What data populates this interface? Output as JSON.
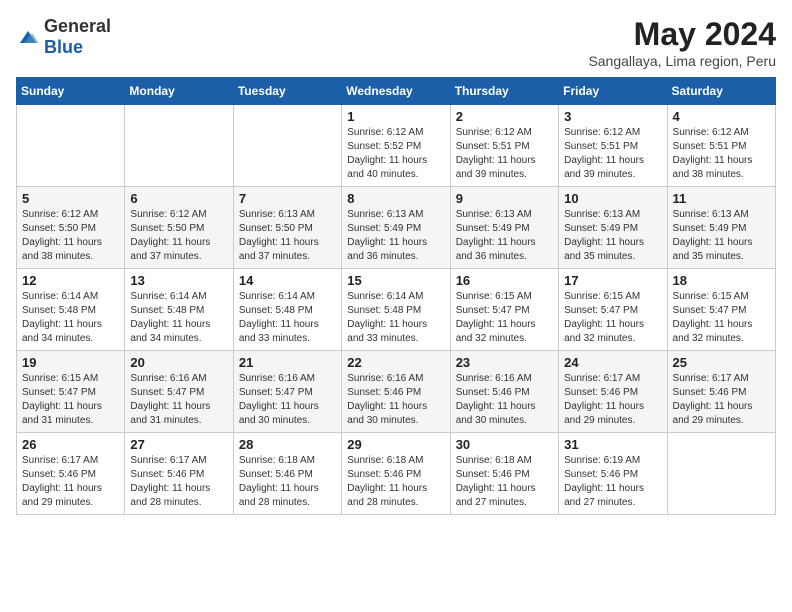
{
  "logo": {
    "text_general": "General",
    "text_blue": "Blue"
  },
  "header": {
    "month_title": "May 2024",
    "location": "Sangallaya, Lima region, Peru"
  },
  "weekdays": [
    "Sunday",
    "Monday",
    "Tuesday",
    "Wednesday",
    "Thursday",
    "Friday",
    "Saturday"
  ],
  "weeks": [
    [
      {
        "day": "",
        "info": ""
      },
      {
        "day": "",
        "info": ""
      },
      {
        "day": "",
        "info": ""
      },
      {
        "day": "1",
        "info": "Sunrise: 6:12 AM\nSunset: 5:52 PM\nDaylight: 11 hours\nand 40 minutes."
      },
      {
        "day": "2",
        "info": "Sunrise: 6:12 AM\nSunset: 5:51 PM\nDaylight: 11 hours\nand 39 minutes."
      },
      {
        "day": "3",
        "info": "Sunrise: 6:12 AM\nSunset: 5:51 PM\nDaylight: 11 hours\nand 39 minutes."
      },
      {
        "day": "4",
        "info": "Sunrise: 6:12 AM\nSunset: 5:51 PM\nDaylight: 11 hours\nand 38 minutes."
      }
    ],
    [
      {
        "day": "5",
        "info": "Sunrise: 6:12 AM\nSunset: 5:50 PM\nDaylight: 11 hours\nand 38 minutes."
      },
      {
        "day": "6",
        "info": "Sunrise: 6:12 AM\nSunset: 5:50 PM\nDaylight: 11 hours\nand 37 minutes."
      },
      {
        "day": "7",
        "info": "Sunrise: 6:13 AM\nSunset: 5:50 PM\nDaylight: 11 hours\nand 37 minutes."
      },
      {
        "day": "8",
        "info": "Sunrise: 6:13 AM\nSunset: 5:49 PM\nDaylight: 11 hours\nand 36 minutes."
      },
      {
        "day": "9",
        "info": "Sunrise: 6:13 AM\nSunset: 5:49 PM\nDaylight: 11 hours\nand 36 minutes."
      },
      {
        "day": "10",
        "info": "Sunrise: 6:13 AM\nSunset: 5:49 PM\nDaylight: 11 hours\nand 35 minutes."
      },
      {
        "day": "11",
        "info": "Sunrise: 6:13 AM\nSunset: 5:49 PM\nDaylight: 11 hours\nand 35 minutes."
      }
    ],
    [
      {
        "day": "12",
        "info": "Sunrise: 6:14 AM\nSunset: 5:48 PM\nDaylight: 11 hours\nand 34 minutes."
      },
      {
        "day": "13",
        "info": "Sunrise: 6:14 AM\nSunset: 5:48 PM\nDaylight: 11 hours\nand 34 minutes."
      },
      {
        "day": "14",
        "info": "Sunrise: 6:14 AM\nSunset: 5:48 PM\nDaylight: 11 hours\nand 33 minutes."
      },
      {
        "day": "15",
        "info": "Sunrise: 6:14 AM\nSunset: 5:48 PM\nDaylight: 11 hours\nand 33 minutes."
      },
      {
        "day": "16",
        "info": "Sunrise: 6:15 AM\nSunset: 5:47 PM\nDaylight: 11 hours\nand 32 minutes."
      },
      {
        "day": "17",
        "info": "Sunrise: 6:15 AM\nSunset: 5:47 PM\nDaylight: 11 hours\nand 32 minutes."
      },
      {
        "day": "18",
        "info": "Sunrise: 6:15 AM\nSunset: 5:47 PM\nDaylight: 11 hours\nand 32 minutes."
      }
    ],
    [
      {
        "day": "19",
        "info": "Sunrise: 6:15 AM\nSunset: 5:47 PM\nDaylight: 11 hours\nand 31 minutes."
      },
      {
        "day": "20",
        "info": "Sunrise: 6:16 AM\nSunset: 5:47 PM\nDaylight: 11 hours\nand 31 minutes."
      },
      {
        "day": "21",
        "info": "Sunrise: 6:16 AM\nSunset: 5:47 PM\nDaylight: 11 hours\nand 30 minutes."
      },
      {
        "day": "22",
        "info": "Sunrise: 6:16 AM\nSunset: 5:46 PM\nDaylight: 11 hours\nand 30 minutes."
      },
      {
        "day": "23",
        "info": "Sunrise: 6:16 AM\nSunset: 5:46 PM\nDaylight: 11 hours\nand 30 minutes."
      },
      {
        "day": "24",
        "info": "Sunrise: 6:17 AM\nSunset: 5:46 PM\nDaylight: 11 hours\nand 29 minutes."
      },
      {
        "day": "25",
        "info": "Sunrise: 6:17 AM\nSunset: 5:46 PM\nDaylight: 11 hours\nand 29 minutes."
      }
    ],
    [
      {
        "day": "26",
        "info": "Sunrise: 6:17 AM\nSunset: 5:46 PM\nDaylight: 11 hours\nand 29 minutes."
      },
      {
        "day": "27",
        "info": "Sunrise: 6:17 AM\nSunset: 5:46 PM\nDaylight: 11 hours\nand 28 minutes."
      },
      {
        "day": "28",
        "info": "Sunrise: 6:18 AM\nSunset: 5:46 PM\nDaylight: 11 hours\nand 28 minutes."
      },
      {
        "day": "29",
        "info": "Sunrise: 6:18 AM\nSunset: 5:46 PM\nDaylight: 11 hours\nand 28 minutes."
      },
      {
        "day": "30",
        "info": "Sunrise: 6:18 AM\nSunset: 5:46 PM\nDaylight: 11 hours\nand 27 minutes."
      },
      {
        "day": "31",
        "info": "Sunrise: 6:19 AM\nSunset: 5:46 PM\nDaylight: 11 hours\nand 27 minutes."
      },
      {
        "day": "",
        "info": ""
      }
    ]
  ]
}
